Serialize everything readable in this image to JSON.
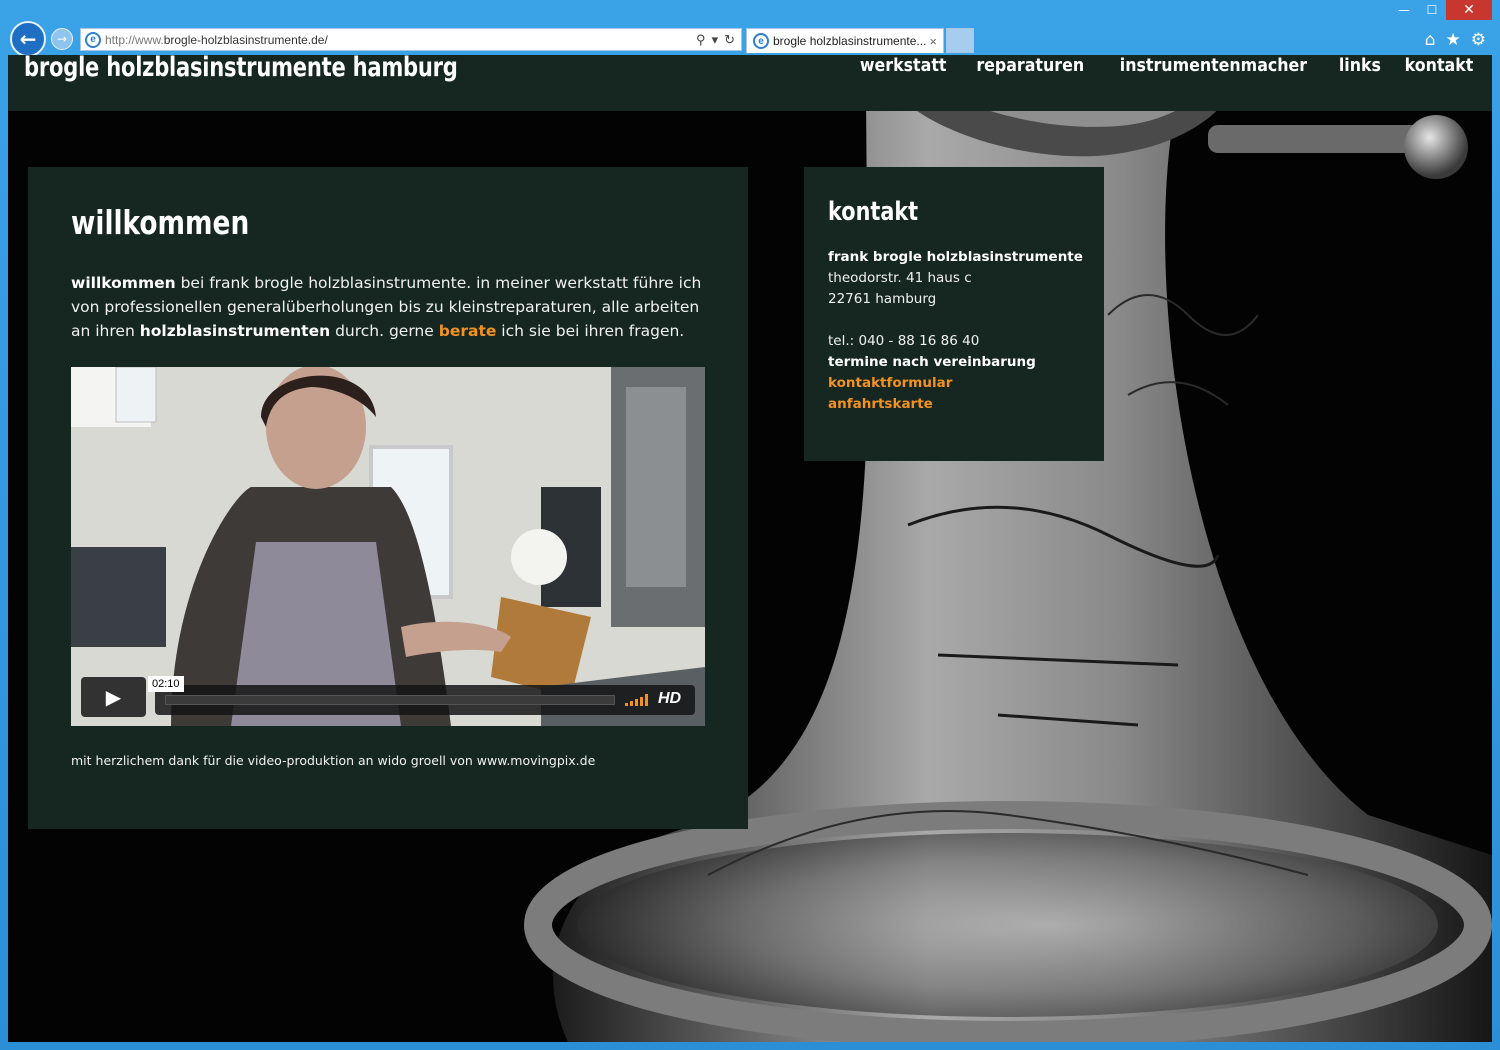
{
  "browser": {
    "address_prefix": "http://www.",
    "address_domain": "brogle-holzblasinstrumente.de/",
    "tab_title": "brogle holzblasinstrumente...",
    "tab_close": "×"
  },
  "header": {
    "site_title": "brogle holzblasinstrumente hamburg",
    "nav": [
      "werkstatt",
      "reparaturen",
      "instrumentenmacher",
      "links",
      "kontakt"
    ]
  },
  "welcome": {
    "title": "willkommen",
    "p1_bold": "willkommen",
    "p1_rest": " bei frank brogle holzblasinstrumente. in meiner werkstatt führe ich von professionellen generalüberholungen bis zu kleinstreparaturen, alle arbeiten an ihren ",
    "p1_bold2": "holzblasinstrumenten",
    "p1_mid": " durch. gerne ",
    "p1_link": "berate",
    "p1_end": " ich sie bei ihren fragen.",
    "video": {
      "time": "02:10",
      "hd": "HD",
      "volume_level": 1.0
    },
    "credit": "mit herzlichem dank für die video-produktion an wido groell von www.movingpix.de"
  },
  "contact": {
    "title": "kontakt",
    "name": "frank brogle holzblasinstrumente",
    "street": "theodorstr. 41 haus c",
    "city": "22761 hamburg",
    "phone": "tel.: 040 - 88 16 86 40",
    "appointment": "termine nach vereinbarung",
    "link_form": "kontaktformular",
    "link_map": "anfahrtskarte"
  },
  "colors": {
    "panel": "#152720",
    "accent": "#f39221",
    "background": "#030303"
  }
}
